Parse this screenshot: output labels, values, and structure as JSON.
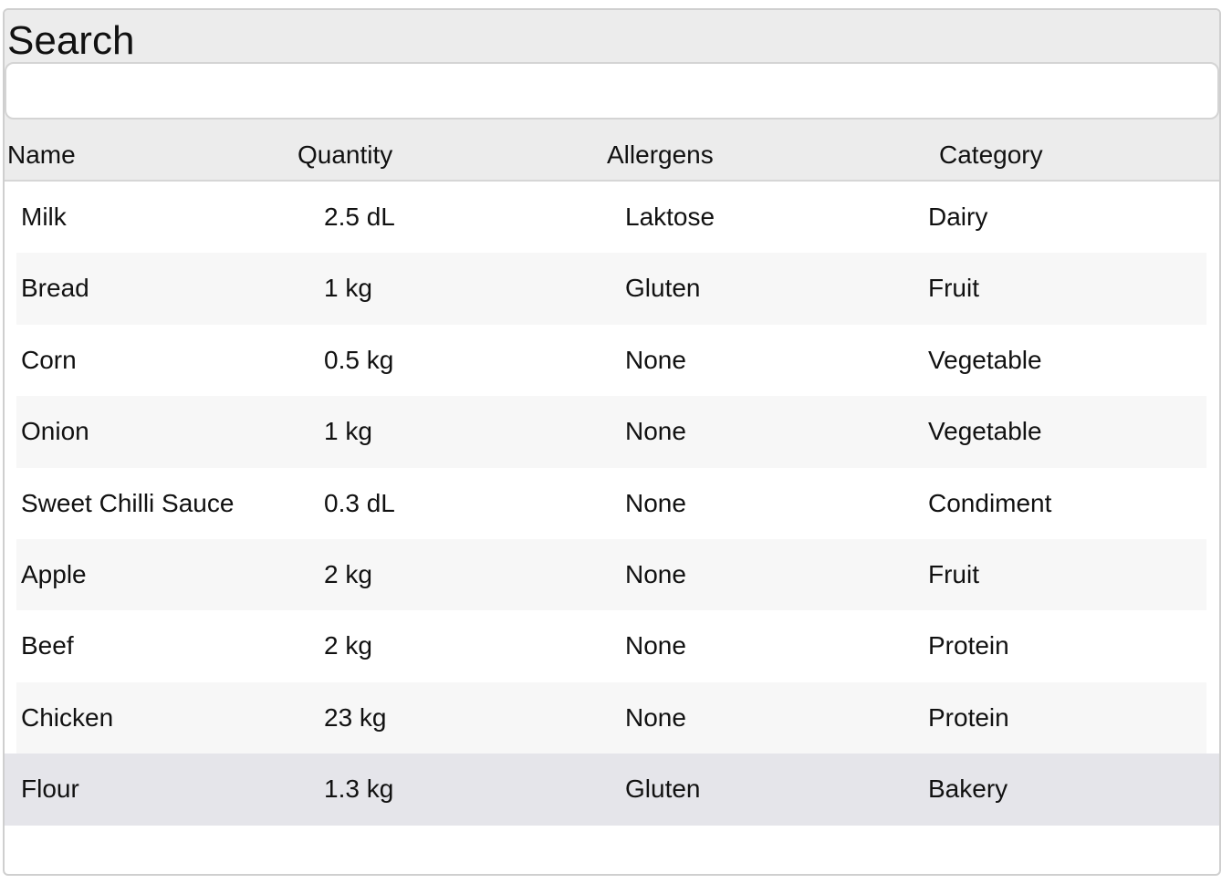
{
  "search": {
    "title": "Search",
    "value": "",
    "placeholder": ""
  },
  "table": {
    "columns": [
      "Name",
      "Quantity",
      "Allergens",
      "Category"
    ],
    "rows": [
      {
        "name": "Milk",
        "quantity": "2.5 dL",
        "allergens": "Laktose",
        "category": "Dairy"
      },
      {
        "name": "Bread",
        "quantity": "1 kg",
        "allergens": "Gluten",
        "category": "Fruit"
      },
      {
        "name": "Corn",
        "quantity": "0.5 kg",
        "allergens": "None",
        "category": "Vegetable"
      },
      {
        "name": "Onion",
        "quantity": "1 kg",
        "allergens": "None",
        "category": "Vegetable"
      },
      {
        "name": "Sweet Chilli Sauce",
        "quantity": "0.3 dL",
        "allergens": "None",
        "category": "Condiment"
      },
      {
        "name": "Apple",
        "quantity": "2 kg",
        "allergens": "None",
        "category": "Fruit"
      },
      {
        "name": "Beef",
        "quantity": "2 kg",
        "allergens": "None",
        "category": "Protein"
      },
      {
        "name": "Chicken",
        "quantity": "23 kg",
        "allergens": "None",
        "category": "Protein"
      },
      {
        "name": "Flour",
        "quantity": "1.3 kg",
        "allergens": "Gluten",
        "category": "Bakery"
      }
    ],
    "selected_row": 8
  },
  "colors": {
    "header_background": "#ececec",
    "alternate_row": "#f7f7f7",
    "selected_row": "#e5e5ea",
    "border": "#cfcfcf"
  }
}
